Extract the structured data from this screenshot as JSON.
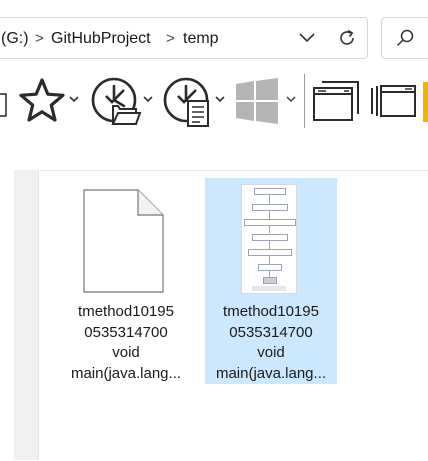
{
  "address_bar": {
    "segments": [
      "(G:)",
      "GitHubProject",
      "temp"
    ],
    "separator": ">"
  },
  "toolbar": {
    "buttons": [
      {
        "name": "pane-toggle",
        "icon": "pane-icon"
      },
      {
        "name": "favorites",
        "icon": "star-icon",
        "has_dropdown": true
      },
      {
        "name": "recent-files",
        "icon": "clock-folder-icon",
        "has_dropdown": true
      },
      {
        "name": "recent-documents",
        "icon": "clock-document-icon",
        "has_dropdown": true
      },
      {
        "name": "start-menu",
        "icon": "windows-icon",
        "has_dropdown": true,
        "disabled": true
      },
      {
        "name": "new-window",
        "icon": "window-stack-icon"
      },
      {
        "name": "multiple-windows",
        "icon": "windows-cascade-icon"
      }
    ]
  },
  "files": [
    {
      "label_lines": [
        "tmethod10195",
        "0535314700",
        "void",
        "main(java.lang..."
      ],
      "type": "generic-file",
      "selected": false
    },
    {
      "label_lines": [
        "tmethod10195",
        "0535314700",
        "void",
        "main(java.lang..."
      ],
      "type": "flowchart-image",
      "selected": true
    }
  ],
  "colors": {
    "selection": "#cce8ff",
    "border": "#d6d6d6",
    "icon": "#333333",
    "disabled_icon": "#b4b4b4",
    "folder_accent": "#f0b400"
  }
}
